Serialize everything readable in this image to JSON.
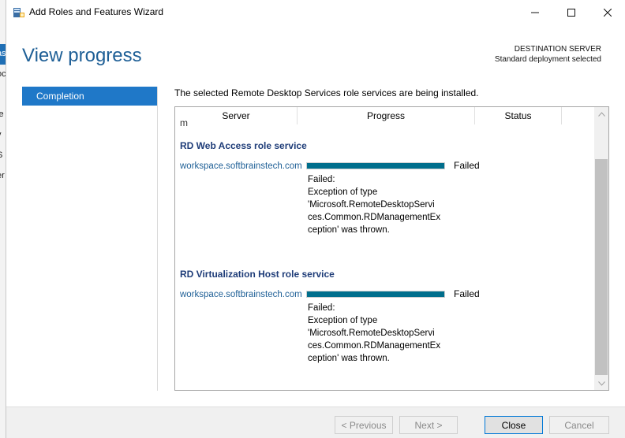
{
  "window": {
    "title": "Add Roles and Features Wizard",
    "minimize_glyph": "—",
    "maximize_glyph": "☐",
    "close_glyph": "✕"
  },
  "background_window": {
    "fragments": [
      "as",
      "oc",
      "l",
      "le",
      "y",
      "S",
      "er"
    ]
  },
  "page_title": "View progress",
  "destination": {
    "label": "DESTINATION SERVER",
    "value": "Standard deployment selected"
  },
  "nav": {
    "items": [
      {
        "label": "Completion",
        "selected": true
      }
    ]
  },
  "intro_text": "The selected Remote Desktop Services role services are being installed.",
  "table": {
    "columns": [
      "Server",
      "Progress",
      "Status",
      ""
    ],
    "clipped_text": "m",
    "sections": [
      {
        "title": "RD Web Access role service",
        "server": "workspace.softbrainstech.com",
        "progress_percent": 100,
        "status": "Failed",
        "detail_lines": [
          "Failed:",
          "Exception of type",
          "'Microsoft.RemoteDesktopServi",
          "ces.Common.RDManagementEx",
          "ception' was thrown."
        ]
      },
      {
        "title": "RD Virtualization Host role service",
        "server": "workspace.softbrainstech.com",
        "progress_percent": 100,
        "status": "Failed",
        "detail_lines": [
          "Failed:",
          "Exception of type",
          "'Microsoft.RemoteDesktopServi",
          "ces.Common.RDManagementEx",
          "ception' was thrown."
        ]
      }
    ]
  },
  "buttons": {
    "previous": "< Previous",
    "next": "Next >",
    "close": "Close",
    "cancel": "Cancel"
  },
  "colors": {
    "title_blue": "#1e5f96",
    "nav_selected": "#1f78c8",
    "progress_fill": "#006e8c"
  }
}
